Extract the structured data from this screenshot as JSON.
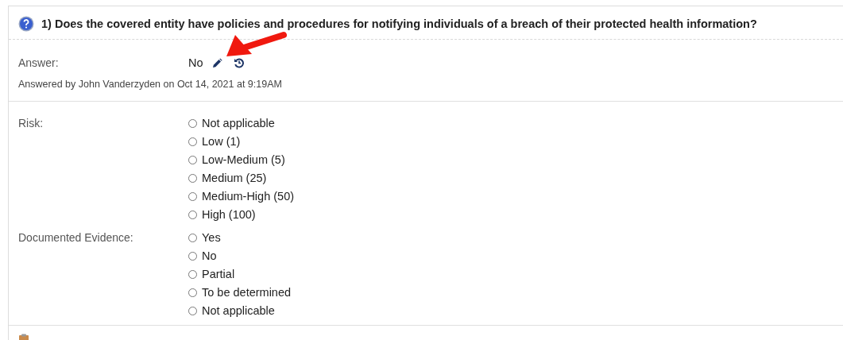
{
  "question": {
    "title": "1) Does the covered entity have policies and procedures for notifying individuals of a breach of their protected health information?"
  },
  "answer": {
    "label": "Answer:",
    "value": "No",
    "answered_by": "Answered by John Vanderzyden on Oct 14, 2021 at 9:19AM"
  },
  "groups": [
    {
      "label": "Risk:",
      "options": [
        {
          "label": "Not applicable",
          "selected": false
        },
        {
          "label": "Low (1)",
          "selected": false
        },
        {
          "label": "Low-Medium (5)",
          "selected": false
        },
        {
          "label": "Medium (25)",
          "selected": false
        },
        {
          "label": "Medium-High (50)",
          "selected": false
        },
        {
          "label": "High (100)",
          "selected": false
        }
      ]
    },
    {
      "label": "Documented Evidence:",
      "options": [
        {
          "label": "Yes",
          "selected": false
        },
        {
          "label": "No",
          "selected": false
        },
        {
          "label": "Partial",
          "selected": false
        },
        {
          "label": "To be determined",
          "selected": false
        },
        {
          "label": "Not applicable",
          "selected": false
        }
      ]
    }
  ]
}
